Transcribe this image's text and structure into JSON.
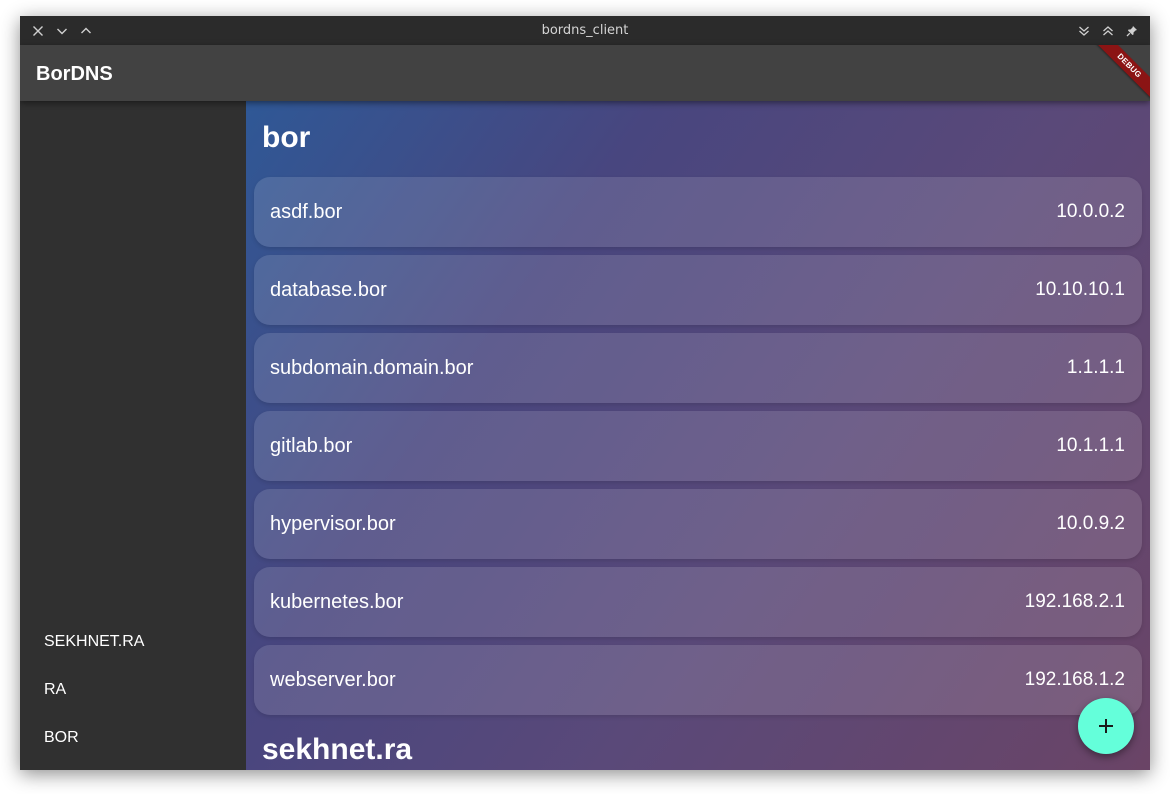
{
  "window": {
    "title": "bordns_client",
    "controls_left": [
      "close-icon",
      "minimize-icon",
      "maximize-icon"
    ],
    "controls_right": [
      "shade-down-icon",
      "shade-up-icon",
      "pin-icon"
    ]
  },
  "appbar": {
    "title": "BorDNS",
    "debug_banner": "DEBUG"
  },
  "sidebar": {
    "items": [
      {
        "label": "SEKHNET.RA"
      },
      {
        "label": "RA"
      },
      {
        "label": "BOR"
      }
    ]
  },
  "main": {
    "sections": [
      {
        "title": "bor",
        "records": [
          {
            "host": "asdf.bor",
            "ip": "10.0.0.2"
          },
          {
            "host": "database.bor",
            "ip": "10.10.10.1"
          },
          {
            "host": "subdomain.domain.bor",
            "ip": "1.1.1.1"
          },
          {
            "host": "gitlab.bor",
            "ip": "10.1.1.1"
          },
          {
            "host": "hypervisor.bor",
            "ip": "10.0.9.2"
          },
          {
            "host": "kubernetes.bor",
            "ip": "192.168.2.1"
          },
          {
            "host": "webserver.bor",
            "ip": "192.168.1.2"
          }
        ]
      },
      {
        "title": "sekhnet.ra",
        "records": []
      }
    ]
  },
  "fab": {
    "icon": "add-icon"
  },
  "colors": {
    "accent": "#64ffda",
    "appbar": "#424242",
    "sidebar": "#303030",
    "gradient_start": "#2f5896",
    "gradient_end": "#6a4466"
  }
}
